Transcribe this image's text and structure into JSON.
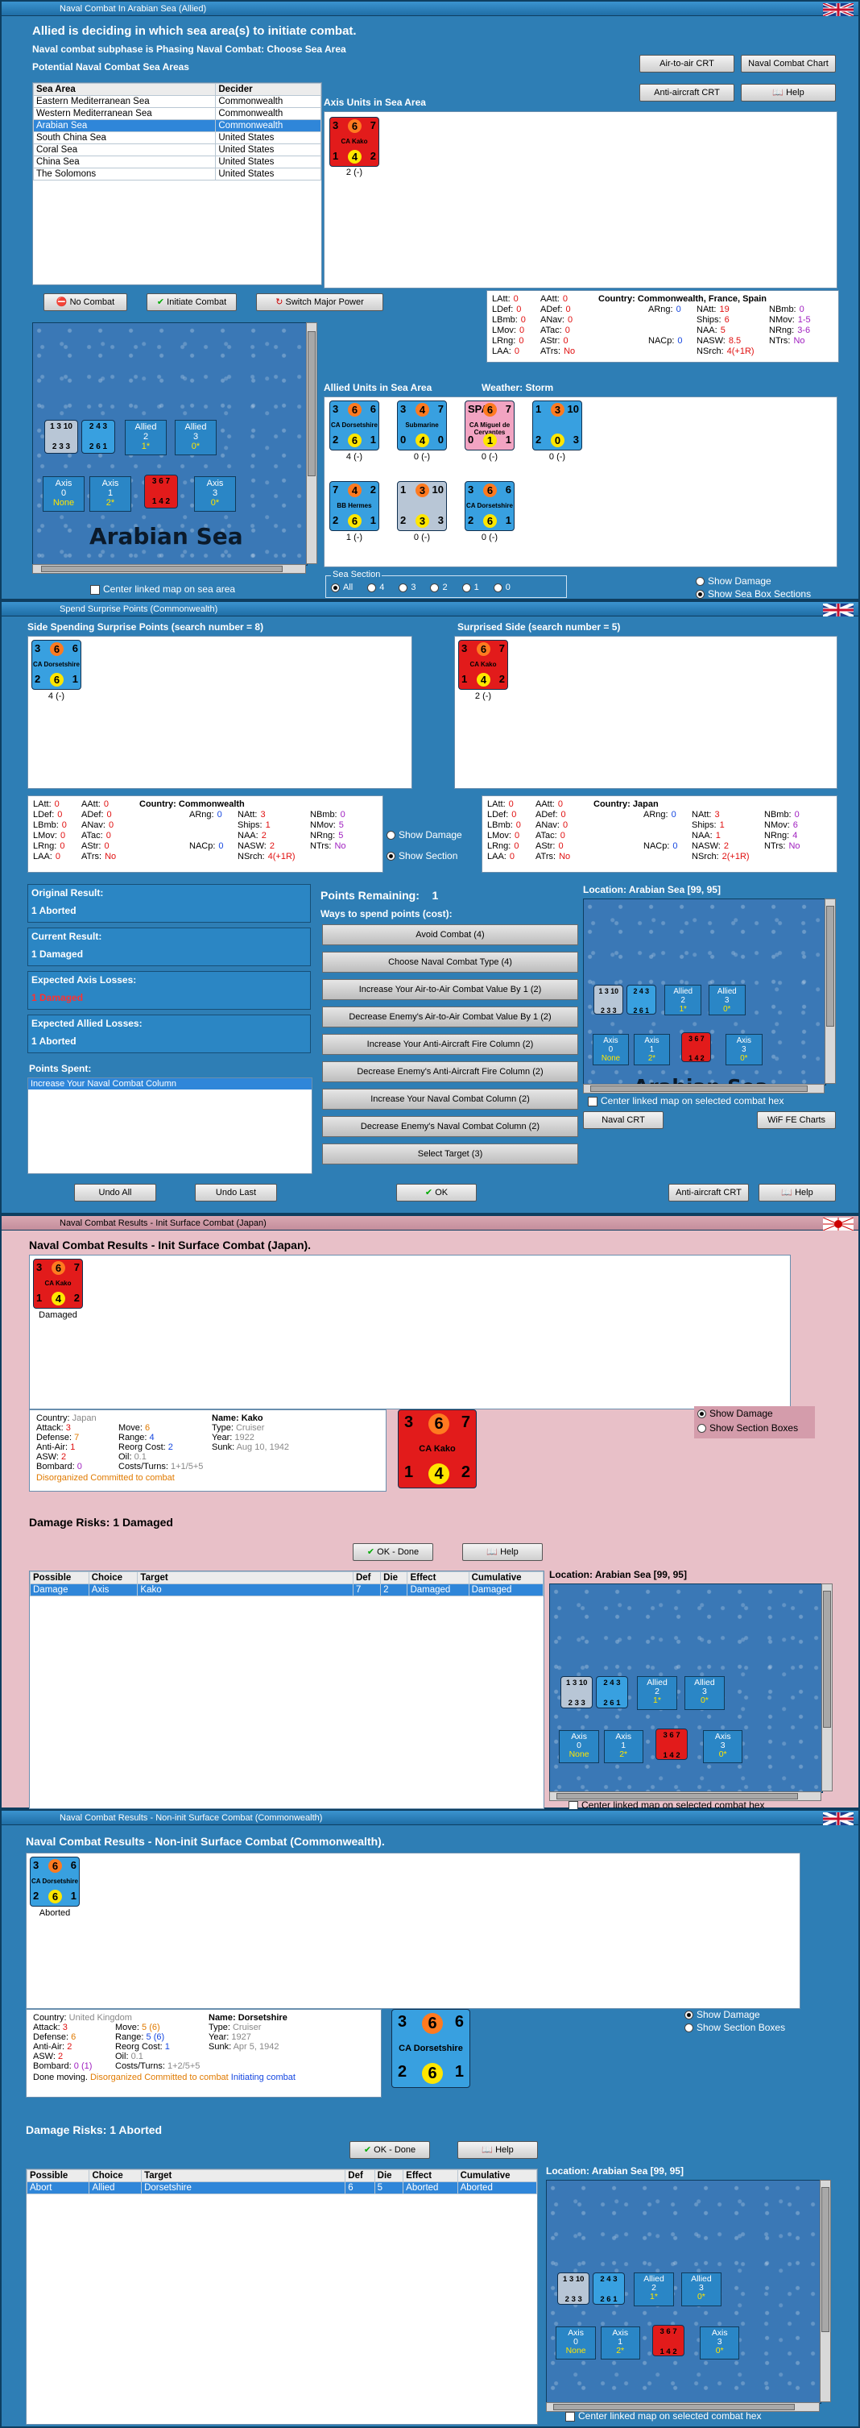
{
  "w1": {
    "title": "Naval Combat In Arabian Sea (Allied)",
    "line1": "Allied is deciding in which sea area(s) to initiate combat.",
    "line2": "Naval combat subphase is Phasing Naval Combat: Choose Sea Area",
    "line3": "Potential Naval Combat Sea Areas",
    "cols": [
      "Sea Area",
      "Decider"
    ],
    "rows": [
      [
        "Eastern Mediterranean Sea",
        "Commonwealth"
      ],
      [
        "Western Mediterranean Sea",
        "Commonwealth"
      ],
      [
        "Arabian Sea",
        "Commonwealth"
      ],
      [
        "South China Sea",
        "United States"
      ],
      [
        "Coral Sea",
        "United States"
      ],
      [
        "China Sea",
        "United States"
      ],
      [
        "The Solomons",
        "United States"
      ]
    ],
    "buttons": {
      "air": "Air-to-air CRT",
      "naval": "Naval Combat Chart",
      "aa": "Anti-aircraft CRT",
      "help": "Help",
      "nocombat": "No Combat",
      "initiate": "Initiate Combat",
      "switch": "Switch Major Power"
    },
    "axis_units_title": "Axis Units in Sea Area",
    "axis_unit": {
      "a": "3",
      "b": "6",
      "c": "7",
      "name": "CA Kako",
      "d": "1",
      "e": "4",
      "f": "2",
      "tag": "2 (-)"
    },
    "stats": {
      "country": "Country: Commonwealth, France, Spain",
      "c1": [
        [
          "LAtt:",
          "0"
        ],
        [
          "LDef:",
          "0"
        ],
        [
          "LBmb:",
          "0"
        ],
        [
          "LMov:",
          "0"
        ],
        [
          "LRng:",
          "0"
        ],
        [
          "LAA:",
          "0"
        ]
      ],
      "c2": [
        [
          "AAtt:",
          "0"
        ],
        [
          "ADef:",
          "0"
        ],
        [
          "ANav:",
          "0"
        ],
        [
          "ATac:",
          "0"
        ],
        [
          "AStr:",
          "0"
        ],
        [
          "ATrs:",
          "No"
        ]
      ],
      "c3": [
        [
          "ARng:",
          "0"
        ],
        [
          "NACp:",
          "0"
        ]
      ],
      "c4": [
        [
          "NAtt:",
          "19"
        ],
        [
          "Ships:",
          "6"
        ],
        [
          "NAA:",
          "5"
        ],
        [
          "NASW:",
          "8.5"
        ],
        [
          "NSrch:",
          "4(+1R)"
        ]
      ],
      "c5": [
        [
          "NBmb:",
          "0"
        ],
        [
          "NMov:",
          "1-5"
        ],
        [
          "NRng:",
          "3-6"
        ],
        [
          "NTrs:",
          "No"
        ]
      ]
    },
    "allied_title": "Allied Units in Sea Area",
    "weather": "Weather:  Storm",
    "allied_units": [
      {
        "a": "3",
        "b": "6",
        "c": "6",
        "name": "CA Dorsetshire",
        "d": "2",
        "e": "6",
        "f": "1",
        "tag": "4 (-)",
        "col": "blue"
      },
      {
        "a": "3",
        "b": "4",
        "c": "7",
        "name": "Submarine",
        "d": "0",
        "e": "4",
        "f": "0",
        "tag": "0 (-)",
        "col": "blue"
      },
      {
        "a": "SPA",
        "b": "6",
        "c": "7",
        "name": "CA Miguel de Cervantes",
        "d": "0",
        "e": "1",
        "f": "1",
        "tag": "0 (-)",
        "col": "pink"
      },
      {
        "a": "1",
        "b": "3",
        "c": "10",
        "name": "",
        "d": "2",
        "e": "0",
        "f": "3",
        "tag": "0 (-)",
        "col": "blue"
      },
      {
        "a": "7",
        "b": "4",
        "c": "2",
        "name": "BB Hermes",
        "d": "2",
        "e": "6",
        "f": "1",
        "tag": "1 (-)",
        "col": "blue"
      },
      {
        "a": "1",
        "b": "3",
        "c": "10",
        "name": "",
        "d": "2",
        "e": "3",
        "f": "3",
        "tag": "0 (-)",
        "col": "gray"
      },
      {
        "a": "3",
        "b": "6",
        "c": "6",
        "name": "CA Dorsetshire",
        "d": "2",
        "e": "6",
        "f": "1",
        "tag": "0 (-)",
        "col": "blue"
      }
    ],
    "sea_name": "Arabian Sea",
    "sea_sections": [
      {
        "side": "Axis",
        "n": "0",
        "v": "None"
      },
      {
        "side": "Axis",
        "n": "1",
        "v": "2*"
      },
      {
        "side": "Axis",
        "n": "3",
        "v": "0*"
      },
      {
        "side": "Allied",
        "n": "2",
        "v": "1*"
      },
      {
        "side": "Allied",
        "n": "3",
        "v": "0*"
      }
    ],
    "center_linked": "Center linked map on sea area",
    "sea_section_label": "Sea Section",
    "sea_section_opts": [
      "All",
      "4",
      "3",
      "2",
      "1",
      "0"
    ],
    "show_damage": "Show Damage",
    "show_sea_box": "Show Sea Box Sections"
  },
  "w2": {
    "title": "Spend Surprise Points (Commonwealth)",
    "left_title": "Side Spending Surprise Points (search number = 8)",
    "right_title": "Surprised Side (search number = 5)",
    "left_tag": "4 (-)",
    "right_tag": "2 (-)",
    "statsL": {
      "country": "Country: Commonwealth",
      "c1": [
        [
          "LAtt:",
          "0"
        ],
        [
          "LDef:",
          "0"
        ],
        [
          "LBmb:",
          "0"
        ],
        [
          "LMov:",
          "0"
        ],
        [
          "LRng:",
          "0"
        ],
        [
          "LAA:",
          "0"
        ]
      ],
      "c2": [
        [
          "AAtt:",
          "0"
        ],
        [
          "ADef:",
          "0"
        ],
        [
          "ANav:",
          "0"
        ],
        [
          "ATac:",
          "0"
        ],
        [
          "AStr:",
          "0"
        ],
        [
          "ATrs:",
          "No"
        ]
      ],
      "c3": [
        [
          "ARng:",
          "0"
        ],
        [
          "NACp:",
          "0"
        ]
      ],
      "c4": [
        [
          "NAtt:",
          "3"
        ],
        [
          "Ships:",
          "1"
        ],
        [
          "NAA:",
          "2"
        ],
        [
          "NASW:",
          "2"
        ],
        [
          "NSrch:",
          "4(+1R)"
        ]
      ],
      "c5": [
        [
          "NBmb:",
          "0"
        ],
        [
          "NMov:",
          "5"
        ],
        [
          "NRng:",
          "5"
        ],
        [
          "NTrs:",
          "No"
        ]
      ]
    },
    "statsR": {
      "country": "Country: Japan",
      "c1": [
        [
          "LAtt:",
          "0"
        ],
        [
          "LDef:",
          "0"
        ],
        [
          "LBmb:",
          "0"
        ],
        [
          "LMov:",
          "0"
        ],
        [
          "LRng:",
          "0"
        ],
        [
          "LAA:",
          "0"
        ]
      ],
      "c2": [
        [
          "AAtt:",
          "0"
        ],
        [
          "ADef:",
          "0"
        ],
        [
          "ANav:",
          "0"
        ],
        [
          "ATac:",
          "0"
        ],
        [
          "AStr:",
          "0"
        ],
        [
          "ATrs:",
          "No"
        ]
      ],
      "c3": [
        [
          "ARng:",
          "0"
        ],
        [
          "NACp:",
          "0"
        ]
      ],
      "c4": [
        [
          "NAtt:",
          "3"
        ],
        [
          "Ships:",
          "1"
        ],
        [
          "NAA:",
          "1"
        ],
        [
          "NASW:",
          "2"
        ],
        [
          "NSrch:",
          "2(+1R)"
        ]
      ],
      "c5": [
        [
          "NBmb:",
          "0"
        ],
        [
          "NMov:",
          "6"
        ],
        [
          "NRng:",
          "4"
        ],
        [
          "NTrs:",
          "No"
        ]
      ]
    },
    "show_damage": "Show Damage",
    "show_section": "Show Section",
    "orig_label": "Original Result:",
    "orig_val": "1 Aborted",
    "curr_label": "Current Result:",
    "curr_val": "1 Damaged",
    "axis_label": "Expected Axis Losses:",
    "axis_val": "1 Damaged",
    "allied_label": "Expected Allied Losses:",
    "allied_val": "1 Aborted",
    "spent_label": "Points Spent:",
    "spent_item": "Increase Your Naval Combat Column",
    "remaining_label": "Points Remaining:",
    "remaining_val": "1",
    "ways_label": "Ways to spend points (cost):",
    "options": [
      "Avoid Combat (4)",
      "Choose Naval Combat Type (4)",
      "Increase Your Air-to-Air Combat Value By 1 (2)",
      "Decrease Enemy's Air-to-Air Combat Value By 1 (2)",
      "Increase Your Anti-Aircraft Fire Column (2)",
      "Decrease Enemy's Anti-Aircraft Fire Column (2)",
      "Increase Your Naval Combat Column (2)",
      "Decrease Enemy's Naval Combat Column (2)",
      "Select Target (3)"
    ],
    "location": "Location: Arabian Sea [99, 95]",
    "center_linked": "Center linked map on selected combat hex",
    "naval_crt": "Naval CRT",
    "wif_fe": "WiF FE Charts",
    "undo_all": "Undo All",
    "undo_last": "Undo Last",
    "ok": "OK",
    "aa_crt": "Anti-aircraft CRT",
    "help": "Help"
  },
  "w3": {
    "title": "Naval Combat Results - Init Surface Combat (Japan)",
    "heading": "Naval Combat Results - Init Surface Combat (Japan).",
    "unit_tag": "Damaged",
    "show_damage": "Show Damage",
    "show_section": "Show Section Boxes",
    "info": {
      "country_l": "Country:",
      "country": "Japan",
      "attack_l": "Attack:",
      "attack": "3",
      "defense_l": "Defense:",
      "defense": "7",
      "aa_l": "Anti-Air:",
      "aa": "1",
      "asw_l": "ASW:",
      "asw": "2",
      "bomb_l": "Bombard:",
      "bomb": "0",
      "move_l": "Move:",
      "move": "6",
      "range_l": "Range:",
      "range": "4",
      "reorg_l": "Reorg Cost:",
      "reorg": "2",
      "oil_l": "Oil:",
      "oil": "0.1",
      "costs_l": "Costs/Turns:",
      "costs": "1+1/5+5",
      "name_l": "Name:",
      "name": "Kako",
      "type_l": "Type:",
      "type": "Cruiser",
      "year_l": "Year:",
      "year": "1922",
      "sunk_l": "Sunk:",
      "sunk": "Aug 10, 1942",
      "status": "Disorganized Committed to combat"
    },
    "damage_risks": "Damage Risks:  1 Damaged",
    "ok_done": "OK - Done",
    "help": "Help",
    "cols": [
      "Possible",
      "Choice",
      "Target",
      "Def",
      "Die",
      "Effect",
      "Cumulative"
    ],
    "row": [
      "Damage",
      "Axis",
      "Kako",
      "7",
      "2",
      "Damaged",
      "Damaged"
    ],
    "location": "Location:  Arabian Sea [99, 95]",
    "center_linked": "Center linked map on selected combat hex"
  },
  "w4": {
    "title": "Naval Combat Results - Non-init Surface Combat (Commonwealth)",
    "heading": "Naval Combat Results - Non-init Surface Combat (Commonwealth).",
    "unit_tag": "Aborted",
    "show_damage": "Show Damage",
    "show_section": "Show Section Boxes",
    "info": {
      "country_l": "Country:",
      "country": "United Kingdom",
      "attack_l": "Attack:",
      "attack": "3",
      "defense_l": "Defense:",
      "defense": "6",
      "aa_l": "Anti-Air:",
      "aa": "2",
      "asw_l": "ASW:",
      "asw": "2",
      "bomb_l": "Bombard:",
      "bomb": "0 (1)",
      "move_l": "Move:",
      "move": "5 (6)",
      "range_l": "Range:",
      "range": "5 (6)",
      "reorg_l": "Reorg Cost:",
      "reorg": "1",
      "oil_l": "Oil:",
      "oil": "0.1",
      "costs_l": "Costs/Turns:",
      "costs": "1+2/5+5",
      "name_l": "Name:",
      "name": "Dorsetshire",
      "type_l": "Type:",
      "type": "Cruiser",
      "year_l": "Year:",
      "year": "1927",
      "sunk_l": "Sunk:",
      "sunk": "Apr 5, 1942",
      "done": "Done moving.",
      "status": "Disorganized Committed to combat",
      "initiating": "Initiating combat"
    },
    "damage_risks": "Damage Risks:  1 Aborted",
    "ok_done": "OK - Done",
    "help": "Help",
    "cols": [
      "Possible",
      "Choice",
      "Target",
      "Def",
      "Die",
      "Effect",
      "Cumulative"
    ],
    "row": [
      "Abort",
      "Allied",
      "Dorsetshire",
      "6",
      "5",
      "Aborted",
      "Aborted"
    ],
    "location": "Location:  Arabian Sea [99, 95]",
    "center_linked": "Center linked map on selected combat hex"
  },
  "colors": {
    "axis_red": "#e21b1b",
    "allied_blue": "#38a0e0",
    "window_blue": "#2e7eb5",
    "results_pink": "#e8c0c8",
    "selection": "#2f86d9"
  }
}
